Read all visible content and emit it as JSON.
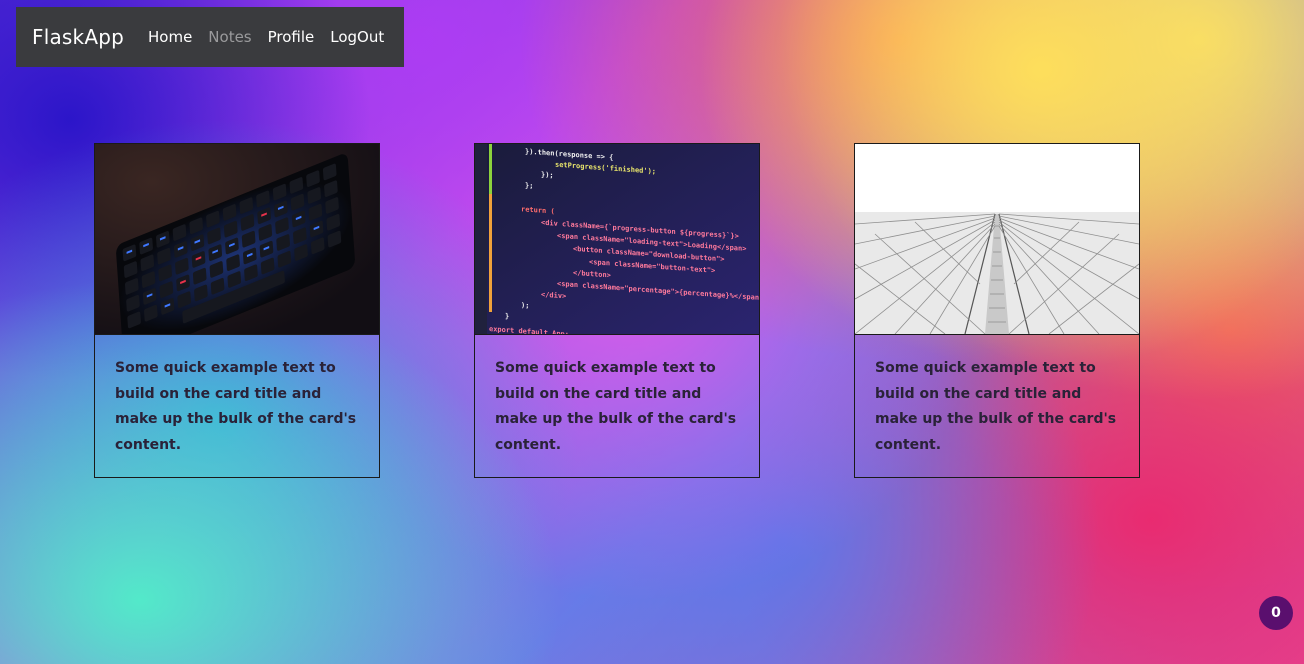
{
  "navbar": {
    "brand": "FlaskApp",
    "links": [
      "Home",
      "Notes",
      "Profile",
      "LogOut"
    ],
    "active": "Notes"
  },
  "cards": [
    {
      "text": "Some quick example text to build on the card title and make up the bulk of the card's content.",
      "image": "keyboard-photo"
    },
    {
      "text": "Some quick example text to build on the card title and make up the bulk of the card's content.",
      "image": "code-screen-photo"
    },
    {
      "text": "Some quick example text to build on the card title and make up the bulk of the card's content.",
      "image": "skyscraper-photo"
    }
  ],
  "badge": {
    "count": "0"
  },
  "code_snippet": {
    "lines": [
      "}).then(response => {",
      "setProgress('finished');",
      "});",
      "};",
      "return (",
      "<div className={`progress-button ${progress}`}>",
      "<span className=\"loading-text\">Loading</span>",
      "<button className=\"download-button\">",
      "<span className=\"button-text\">",
      "</button>",
      "<span className=\"percentage\">{percentage}%</span>",
      "</div>",
      ");",
      "}",
      "export default App;"
    ]
  },
  "colors": {
    "navbar_bg": "#3a3b3e",
    "nav_active": "#9a9a9c",
    "badge_bg": "#5a0f6e",
    "card_text": "#2a2238"
  }
}
